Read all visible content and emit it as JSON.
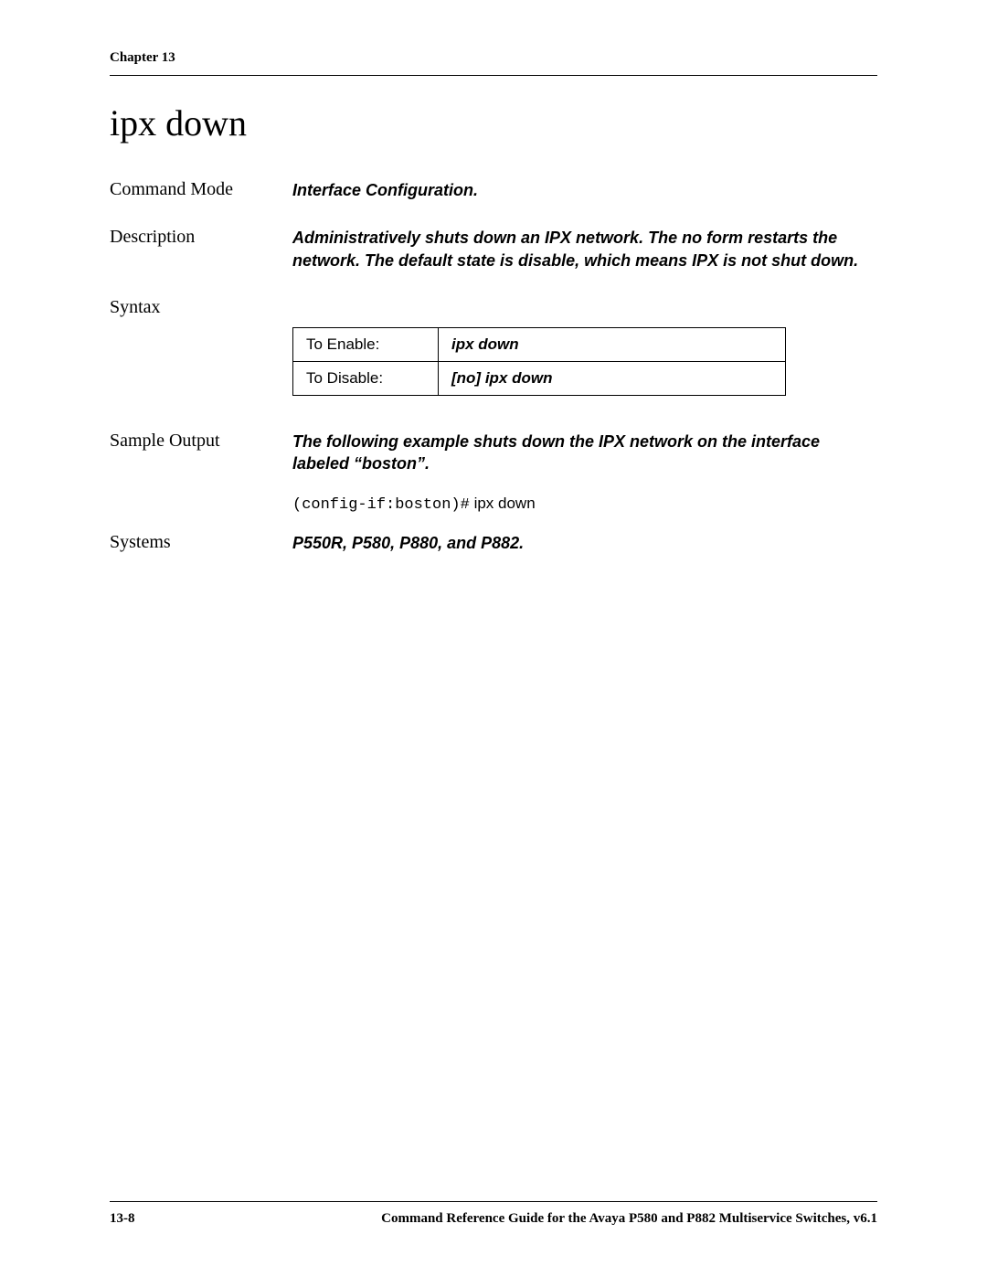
{
  "header": {
    "chapter": "Chapter 13"
  },
  "title": "ipx down",
  "sections": {
    "command_mode": {
      "label": "Command Mode",
      "value": "Interface Configuration."
    },
    "description": {
      "label": "Description",
      "value": "Administratively shuts down an IPX network. The no form restarts the network. The default state is disable, which means IPX is not shut down."
    },
    "syntax": {
      "label": "Syntax",
      "rows": [
        {
          "left": "To Enable:",
          "right": "ipx down"
        },
        {
          "left": "To Disable:",
          "right": "[no] ipx down"
        }
      ]
    },
    "sample_output": {
      "label": "Sample Output",
      "intro": "The following example shuts down the IPX network on the interface labeled “boston”.",
      "prompt": "(config-if:boston)#",
      "command": " ipx down"
    },
    "systems": {
      "label": "Systems",
      "value": "P550R, P580, P880, and P882."
    }
  },
  "footer": {
    "page": "13-8",
    "doc_title": "Command Reference Guide for the Avaya P580 and P882 Multiservice Switches, v6.1"
  }
}
